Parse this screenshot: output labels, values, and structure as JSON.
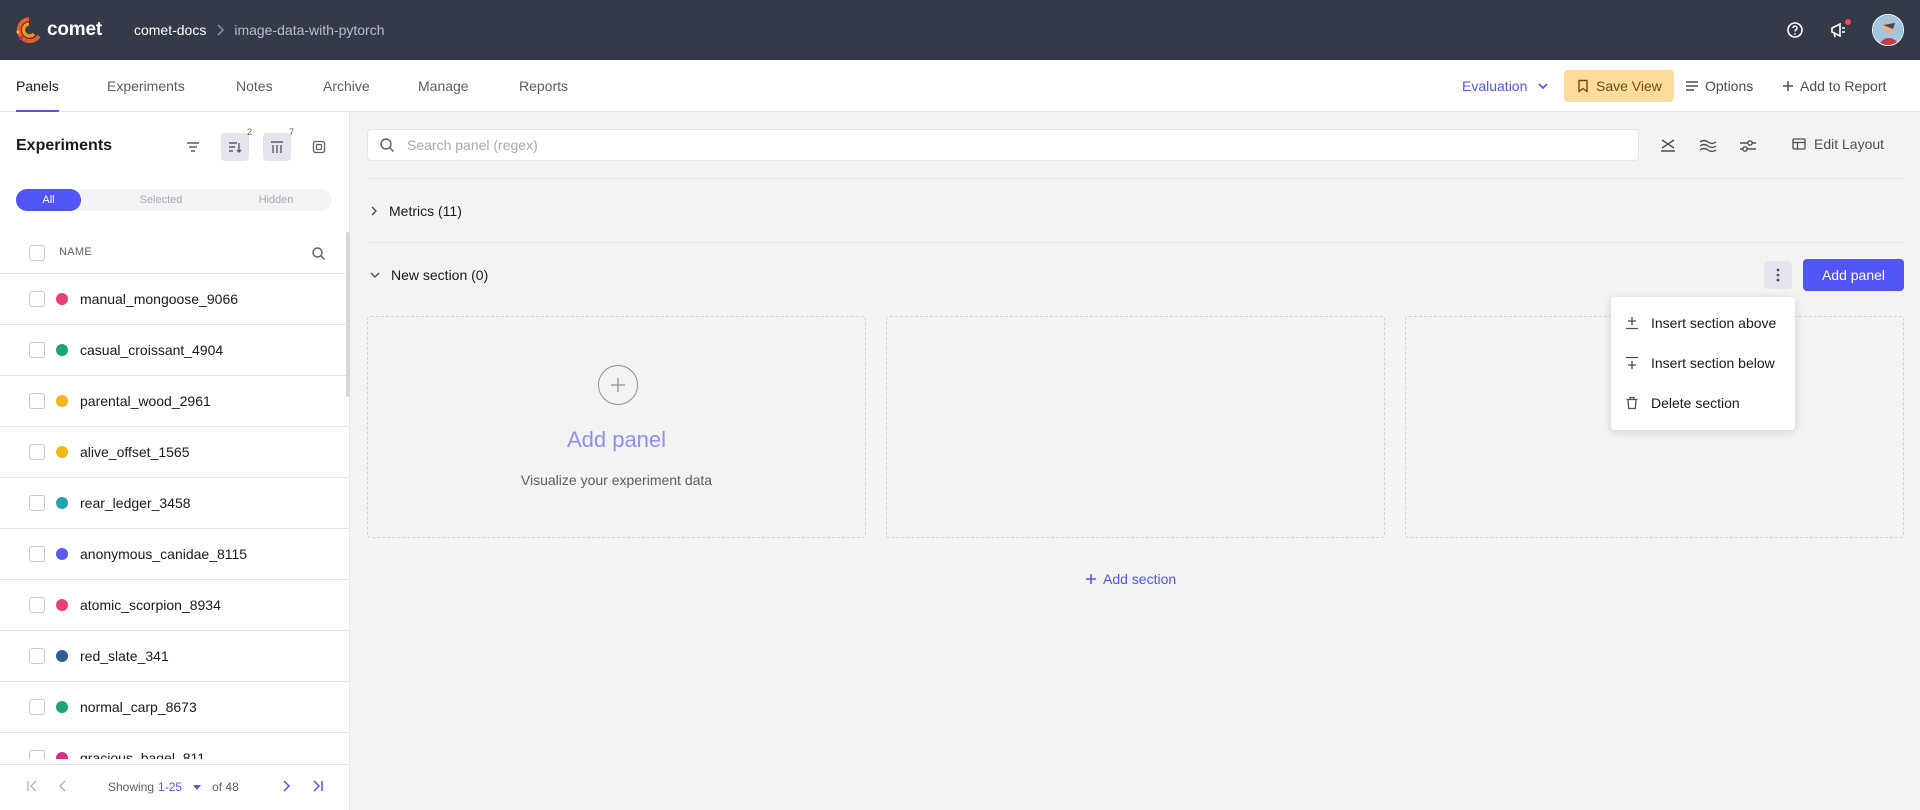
{
  "app": {
    "brand": "comet",
    "breadcrumb": {
      "workspace": "comet-docs",
      "project": "image-data-with-pytorch"
    },
    "top_icons": [
      "help-icon",
      "announcement-icon",
      "user-avatar"
    ]
  },
  "tabs": {
    "items": [
      "Panels",
      "Experiments",
      "Notes",
      "Archive",
      "Manage",
      "Reports"
    ],
    "active": "Panels",
    "view_selector": "Evaluation",
    "save_view": "Save View",
    "options": "Options",
    "add_to_report": "Add to Report"
  },
  "sidebar": {
    "title": "Experiments",
    "sort_badge": "2",
    "columns_badge": "7",
    "filter_segments": [
      "All",
      "Selected",
      "Hidden"
    ],
    "active_segment": "All",
    "column_header": "NAME",
    "experiments": [
      {
        "name": "manual_mongoose_9066",
        "color": "#e8416f"
      },
      {
        "name": "casual_croissant_4904",
        "color": "#1ea672"
      },
      {
        "name": "parental_wood_2961",
        "color": "#f5b51b"
      },
      {
        "name": "alive_offset_1565",
        "color": "#f5b51b"
      },
      {
        "name": "rear_ledger_3458",
        "color": "#21a5a8"
      },
      {
        "name": "anonymous_canidae_8115",
        "color": "#5a5cf0"
      },
      {
        "name": "atomic_scorpion_8934",
        "color": "#e8416f"
      },
      {
        "name": "red_slate_341",
        "color": "#2e5d91"
      },
      {
        "name": "normal_carp_8673",
        "color": "#1ea672"
      },
      {
        "name": "gracious_bagel_811",
        "color": "#d6337e"
      }
    ],
    "pagination": {
      "showing_label": "Showing",
      "range": "1-25",
      "total_label": "of 48"
    }
  },
  "main": {
    "search_placeholder": "Search panel (regex)",
    "edit_layout": "Edit Layout",
    "sections": [
      {
        "title": "Metrics (11)",
        "expanded": false
      },
      {
        "title": "New section (0)",
        "expanded": true
      }
    ],
    "add_panel_button": "Add panel",
    "empty_slot": {
      "title": "Add panel",
      "subtitle": "Visualize your experiment data"
    },
    "add_section": "Add section",
    "section_menu": [
      "Insert section above",
      "Insert section below",
      "Delete section"
    ]
  },
  "colors": {
    "accent": "#5155f5",
    "topbar": "#353a48",
    "save_view_bg": "#fddc9b"
  }
}
